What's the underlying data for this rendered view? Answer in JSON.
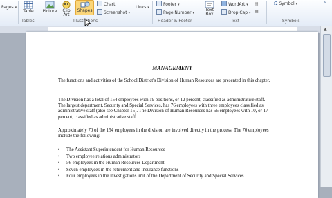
{
  "ribbon": {
    "pages_label": "Pages",
    "tables_group": {
      "table_label": "Table",
      "group_label": "Tables"
    },
    "illustrations_group": {
      "picture_label": "Picture",
      "clip_art_label": "Clip Art",
      "shapes_label": "Shapes",
      "chart_label": "Chart",
      "screenshot_label": "Screenshot",
      "group_label": "Illustrations"
    },
    "links_label": "Links",
    "header_footer_group": {
      "footer_label": "Footer",
      "page_number_label": "Page Number",
      "group_label": "Header & Footer"
    },
    "text_group": {
      "text_box_label": "Text Box",
      "wordart_label": "WordArt",
      "drop_cap_label": "Drop Cap",
      "group_label": "Text"
    },
    "symbols_group": {
      "symbol_label": "Symbol",
      "group_label": "Symbols"
    }
  },
  "document": {
    "title": "MANAGEMENT",
    "paragraphs": [
      "The functions and activities of the School District's Division of Human Resources are presented in this chapter.",
      "The Division has a total of 154 employees with 19 positions, or 12 percent, classified as administrative staff. The largest department, Security and Special Services, has 76 employees with three employees classified as administrative staff (also see Chapter 15). The Division of Human Resources has 56 employees with 10, or 17 percent, classified as administrative staff.",
      "Approximately 70 of the 154 employees in the division are involved directly in the process. The 70 employees include the following:"
    ],
    "bullets": [
      "The Assistant Superintendent for Human Resources",
      "Two employee relations administrators",
      "56 employees in the Human Resources Department",
      "Seven employees in the retirement and insurance functions",
      "Four employees in the investigations unit of the Department of Security and Special Services"
    ]
  },
  "colors": {
    "ribbon_bg": "#e4ecf7",
    "workspace_bg": "#a8b0bc",
    "accent": "#f6c35b"
  }
}
